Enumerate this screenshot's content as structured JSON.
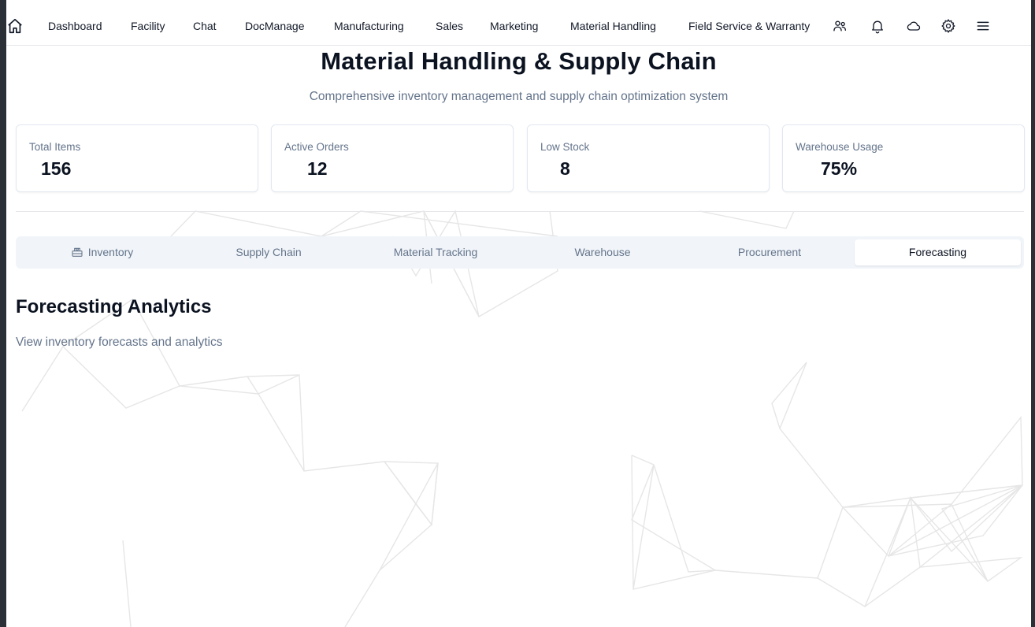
{
  "nav": {
    "items": [
      "Dashboard",
      "Facility",
      "Chat",
      "DocManage",
      "Manufacturing",
      "Sales",
      "Marketing",
      "Material Handling",
      "Field Service & Warranty"
    ],
    "icons": [
      "home-icon",
      "users-icon",
      "bell-icon",
      "cloud-icon",
      "gear-icon",
      "menu-icon"
    ]
  },
  "header": {
    "title": "Material Handling & Supply Chain",
    "subtitle": "Comprehensive inventory management and supply chain optimization system"
  },
  "stats": [
    {
      "label": "Total Items",
      "value": "156"
    },
    {
      "label": "Active Orders",
      "value": "12"
    },
    {
      "label": "Low Stock",
      "value": "8"
    },
    {
      "label": "Warehouse Usage",
      "value": "75%"
    }
  ],
  "tabs": [
    {
      "label": "Inventory",
      "icon": "package-icon"
    },
    {
      "label": "Supply Chain"
    },
    {
      "label": "Material Tracking"
    },
    {
      "label": "Warehouse"
    },
    {
      "label": "Procurement"
    },
    {
      "label": "Forecasting",
      "active": true
    }
  ],
  "section": {
    "title": "Forecasting Analytics",
    "subtitle": "View inventory forecasts and analytics"
  },
  "colors": {
    "text_primary": "#0b1220",
    "text_muted": "#64748b",
    "border": "#e2e8f0",
    "tab_bg": "#f1f5f9",
    "mesh": "#e5e5e5"
  }
}
